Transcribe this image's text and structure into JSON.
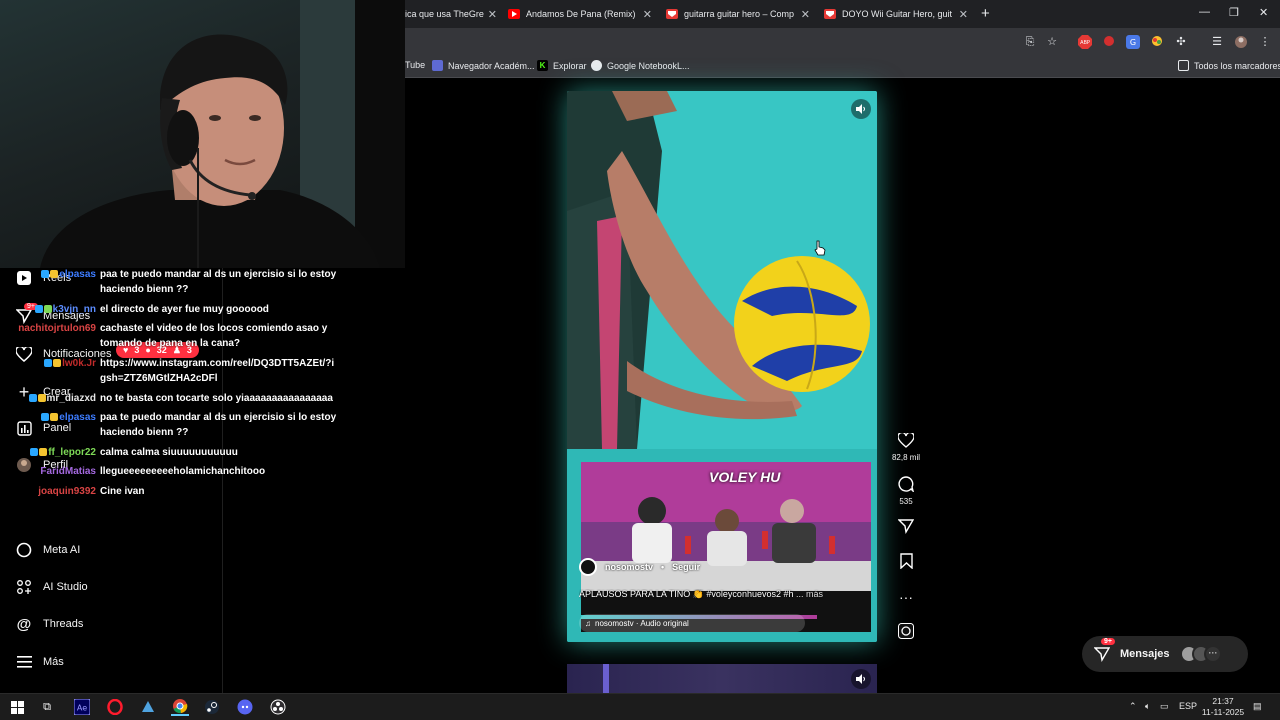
{
  "browser": {
    "tabs": [
      {
        "title": "ica que usa TheGre",
        "favicon": "youtube-icon",
        "active": false
      },
      {
        "title": "Andamos De Pana (Remix) - Yo",
        "favicon": "youtube-icon",
        "active": false
      },
      {
        "title": "guitarra guitar hero – Compra",
        "favicon": "mercado-icon",
        "active": false
      },
      {
        "title": "DOYO Wii Guitar Hero, guitarra",
        "favicon": "mercado-icon",
        "active": false
      }
    ],
    "bookmarks": [
      {
        "label": "Tube",
        "icon": "youtube-icon"
      },
      {
        "label": "Navegador Académ...",
        "icon": "globe-icon"
      },
      {
        "label": "Explorar",
        "icon": "kick-icon"
      },
      {
        "label": "Google NotebookL...",
        "icon": "notebooklm-icon"
      }
    ],
    "all_bookmarks_label": "Todos los marcadores"
  },
  "sidebar": {
    "items": [
      {
        "label": "Reels",
        "icon": "reels-icon"
      },
      {
        "label": "Mensajes",
        "icon": "messages-icon",
        "badge": "9+"
      },
      {
        "label": "Notificaciones",
        "icon": "heart-icon"
      },
      {
        "label": "Crear",
        "icon": "plus-icon"
      },
      {
        "label": "Panel",
        "icon": "chart-icon"
      },
      {
        "label": "Perfil",
        "icon": "avatar-icon"
      },
      {
        "label": "Meta AI",
        "icon": "meta-ai-icon"
      },
      {
        "label": "AI Studio",
        "icon": "ai-studio-icon"
      },
      {
        "label": "Threads",
        "icon": "threads-icon"
      },
      {
        "label": "Más",
        "icon": "menu-icon"
      }
    ],
    "notification_popup": {
      "likes": "3",
      "comments": "32",
      "follows": "3"
    }
  },
  "chat": {
    "messages": [
      {
        "user": "elpasas",
        "color": "#3d7cff",
        "text": "paa te puedo mandar al ds un ejercisio si lo estoy haciendo bienn ??"
      },
      {
        "user": "k3vjn_nn",
        "color": "#5c8dff",
        "text": "el directo de ayer fue muy goooood"
      },
      {
        "user": "nachitojrtulon69",
        "color": "#d94444",
        "text": "cachaste el video de los locos comiendo asao y tomando de pana en la cana?"
      },
      {
        "user": "lw0k.Jr",
        "color": "#c22b2b",
        "text": "https://www.instagram.com/reel/DQ3DTT5AZEt/?igsh=ZTZ6MGtlZHA2cDFl"
      },
      {
        "user": "mr_diazxd",
        "color": "#e6e6e6",
        "text": "no te basta con tocarte solo yiaaaaaaaaaaaaaaaa"
      },
      {
        "user": "elpasas",
        "color": "#3d7cff",
        "text": "paa te puedo mandar al ds un ejercisio si lo estoy haciendo bienn ??"
      },
      {
        "user": "ff_lepor22",
        "color": "#7ed957",
        "text": "calma calma siuuuuuuuuuuu"
      },
      {
        "user": "FaridMatias",
        "color": "#a569e0",
        "text": "llegueeeeeeeeeholamichanchitooo"
      },
      {
        "user": "joaquin9392",
        "color": "#d94444",
        "text": "Cine ivan"
      }
    ]
  },
  "reel": {
    "account": "nosomostv",
    "follow_label": "Seguir",
    "caption": "APLAUSOS PARA LA TINO 👏 #voleyconhuevos2 #h",
    "more_label": "... más",
    "audio": "nosomostv · Audio original",
    "studio_sign": "VOLEY HU",
    "likes": "82,8 mil",
    "comments": "535"
  },
  "messages_pill": {
    "label": "Mensajes",
    "badge": "9+"
  },
  "taskbar": {
    "language": "ESP",
    "time": "21:37",
    "date": "11-11-2025"
  },
  "colors": {
    "accent_red": "#ff3040",
    "teal_glow": "#40e0d0",
    "ball_yellow": "#f2d21b",
    "ball_blue": "#1f3fa8"
  }
}
